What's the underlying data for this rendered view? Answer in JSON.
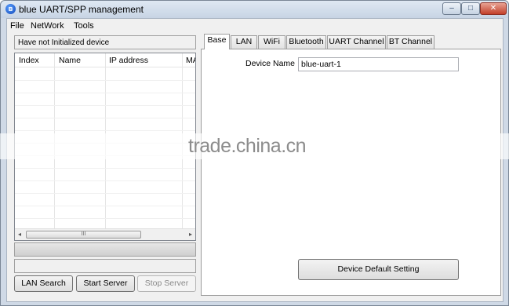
{
  "window": {
    "title": "blue UART/SPP management",
    "controls": {
      "minimize": "–",
      "maximize": "□",
      "close": "✕"
    }
  },
  "menu": [
    "File",
    "NetWork",
    "Tools"
  ],
  "left_panel": {
    "status_text": "Have not Initialized device",
    "device_list": {
      "columns": [
        "Index",
        "Name",
        "IP address",
        "MA"
      ],
      "rows": [],
      "hscroll": {
        "left": "◂",
        "thumb": "III",
        "right": "▸"
      }
    },
    "buttons": {
      "lan_search": "LAN Search",
      "start_server": "Start Server",
      "stop_server": "Stop Server"
    }
  },
  "tabs": [
    "Base",
    "LAN",
    "WiFi",
    "Bluetooth",
    "UART Channel",
    "BT Channel"
  ],
  "active_tab": "Base",
  "base_tab": {
    "device_name_label": "Device Name",
    "device_name_value": "blue-uart-1",
    "default_button": "Device Default Setting"
  },
  "watermark": "trade.china.cn"
}
